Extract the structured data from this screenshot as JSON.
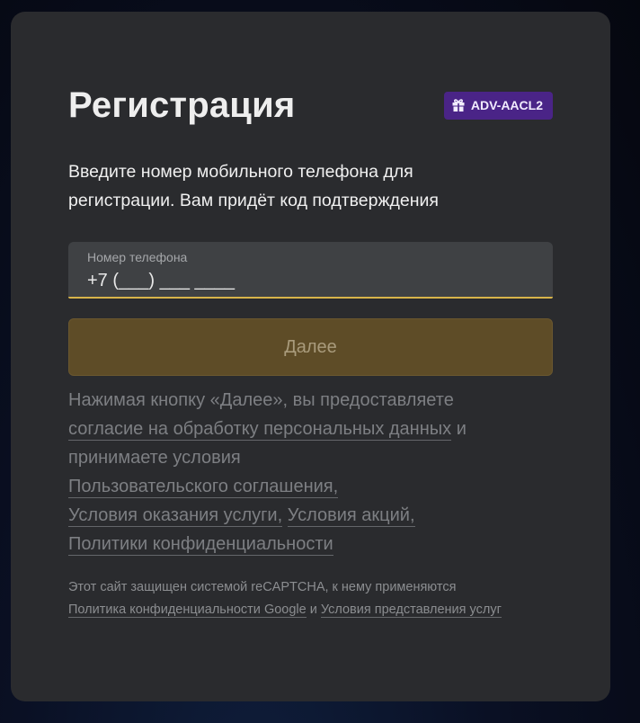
{
  "card": {
    "title": "Регистрация",
    "promo_code": "ADV-AACL2",
    "subtitle_line1": "Введите номер мобильного телефона для",
    "subtitle_line2": "регистрации. Вам придёт код подтверждения"
  },
  "phone_field": {
    "label": "Номер телефона",
    "value": "+7 (___) ___ ____"
  },
  "next_button": {
    "label": "Далее"
  },
  "consent": {
    "text_1": "Нажимая кнопку «Далее», вы предоставляете",
    "link_personal_data": "согласие на обработку персональных данных",
    "text_2": "и",
    "text_3": "принимаете условия",
    "link_user_agreement": "Пользовательского соглашения,",
    "link_service_terms": "Условия оказания услуги,",
    "link_promo_terms": "Условия акций,",
    "link_privacy": "Политики конфиденциальности"
  },
  "recaptcha": {
    "text_1": "Этот сайт защищен системой reCAPTCHA, к нему применяются",
    "link_google_privacy": "Политика конфиденциальности Google",
    "text_2": "и",
    "link_terms": "Условия представления услуг"
  },
  "colors": {
    "card_bg": "#2a2b2e",
    "promo_bg": "#4a2487",
    "accent": "#d8b44a",
    "button_disabled_bg": "#5e4c27"
  },
  "icons": {
    "promo": "gift-icon"
  }
}
